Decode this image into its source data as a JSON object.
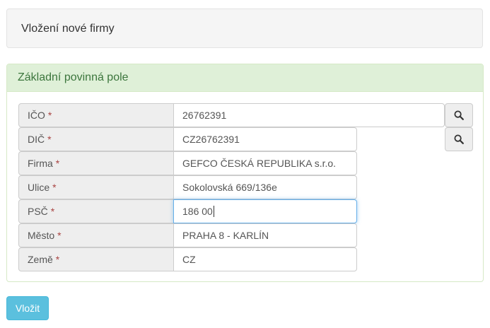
{
  "header": {
    "title": "Vložení nové firmy"
  },
  "panel": {
    "title": "Základní povinná pole"
  },
  "required_marker": "*",
  "fields": [
    {
      "label": "IČO",
      "value": "26762391"
    },
    {
      "label": "DIČ",
      "value": "CZ26762391"
    },
    {
      "label": "Firma",
      "value": "GEFCO ČESKÁ REPUBLIKA s.r.o."
    },
    {
      "label": "Ulice",
      "value": "Sokolovská 669/136e"
    },
    {
      "label": "PSČ",
      "value": "186 00"
    },
    {
      "label": "Město",
      "value": "PRAHA 8 - KARLÍN"
    },
    {
      "label": "Země",
      "value": "CZ"
    }
  ],
  "icons": {
    "lookup": "search-icon"
  },
  "colors": {
    "panel_heading_bg": "#dff0d8",
    "panel_heading_text": "#3c763d",
    "required": "#a94442",
    "button": "#5bc0de",
    "focus_border": "#66afe9"
  },
  "submit_label": "Vložit"
}
